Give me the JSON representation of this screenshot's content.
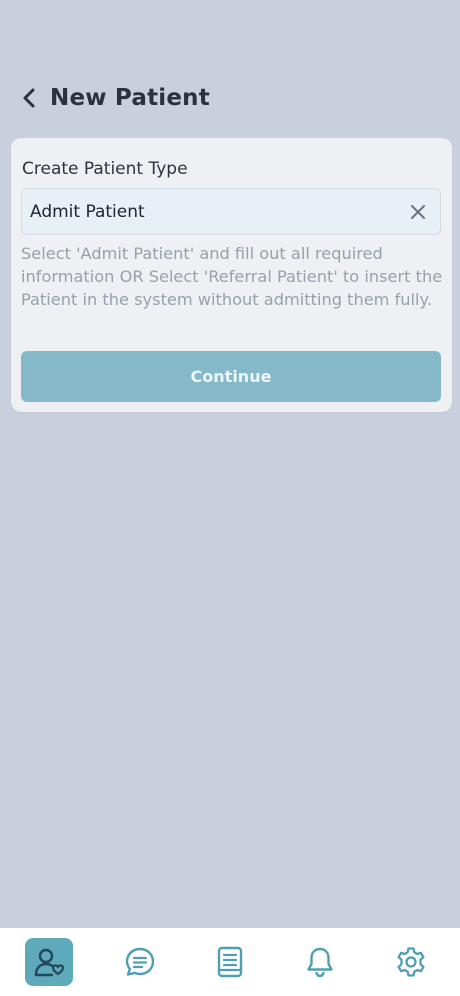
{
  "header": {
    "title": "New Patient",
    "back_icon": "chevron-left-icon"
  },
  "form": {
    "field_label": "Create Patient Type",
    "selected_value": "Admit Patient",
    "clear_icon": "close-icon",
    "help_text": "Select 'Admit Patient' and fill out all required information OR Select 'Referral Patient' to insert the Patient in the system without admitting them fully.",
    "continue_label": "Continue"
  },
  "bottom_nav": {
    "items": [
      {
        "icon": "patients-icon",
        "active": true
      },
      {
        "icon": "chat-icon",
        "active": false
      },
      {
        "icon": "book-icon",
        "active": false
      },
      {
        "icon": "bell-icon",
        "active": false
      },
      {
        "icon": "gear-icon",
        "active": false
      }
    ]
  },
  "colors": {
    "background": "#c9cfdc",
    "accent": "#5fa9bc",
    "button": "#85b9c9",
    "nav_icon": "#4f9fb3"
  }
}
